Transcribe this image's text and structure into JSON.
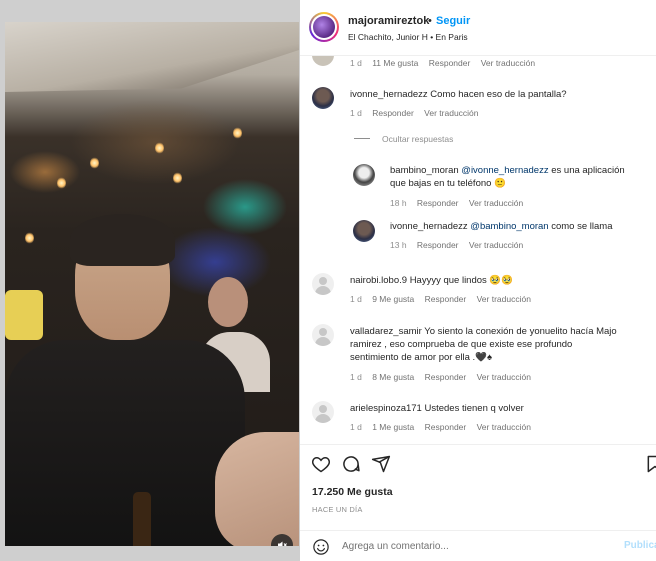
{
  "header": {
    "username": "majoramireztok",
    "separator": "•",
    "follow_label": "Seguir",
    "subtitle": "El Chachito, Junior H • En Paris"
  },
  "comments": [
    {
      "id": "top-partial",
      "meta": {
        "time": "1 d",
        "likes": "11 Me gusta",
        "reply": "Responder",
        "translate": "Ver traducción"
      }
    },
    {
      "id": "ivonne1",
      "username": "ivonne_hernadezz",
      "text": "Como hacen eso de la pantalla?",
      "meta": {
        "time": "1 d",
        "reply": "Responder",
        "translate": "Ver traducción"
      }
    },
    {
      "id": "hide-replies",
      "label": "Ocultar respuestas"
    },
    {
      "id": "bambino",
      "username": "bambino_moran",
      "mention": "@ivonne_hernadezz",
      "text_after": " es una aplicación que bajas en tu teléfono 🙂",
      "meta": {
        "time": "18 h",
        "reply": "Responder",
        "translate": "Ver traducción"
      }
    },
    {
      "id": "ivonne2",
      "username": "ivonne_hernadezz",
      "mention": "@bambino_moran",
      "text_after": " como se llama",
      "meta": {
        "time": "13 h",
        "reply": "Responder",
        "translate": "Ver traducción"
      }
    },
    {
      "id": "nairobi",
      "username": "nairobi.lobo.9",
      "text": "Hayyyy que lindos 🥹🥹",
      "meta": {
        "time": "1 d",
        "likes": "9 Me gusta",
        "reply": "Responder",
        "translate": "Ver traducción"
      }
    },
    {
      "id": "valladarez",
      "username": "valladarez_samir",
      "text_line1": "Yo siento la conexión de yonuelito hacía Majo",
      "text_line2": "ramirez , eso comprueba de que existe ese profundo",
      "text_line3": "sentimiento de amor por ella .🖤♠",
      "meta": {
        "time": "1 d",
        "likes": "8 Me gusta",
        "reply": "Responder",
        "translate": "Ver traducción"
      }
    },
    {
      "id": "ariel",
      "username": "arielespinoza171",
      "text": "Ustedes tienen q volver",
      "meta": {
        "time": "1 d",
        "likes": "1 Me gusta",
        "reply": "Responder",
        "translate": "Ver traducción"
      }
    }
  ],
  "actions": {
    "likes": "17.250 Me gusta",
    "time": "HACE UN DÍA"
  },
  "composer": {
    "placeholder": "Agrega un comentario...",
    "post_label": "Publicar"
  },
  "icons": [
    "heart-icon",
    "comment-icon",
    "share-icon",
    "save-icon",
    "emoji-icon",
    "mute-icon",
    "like-heart-icon"
  ],
  "colors": {
    "accent": "#0095f6",
    "text": "#262626",
    "muted": "#8e8e8e"
  }
}
